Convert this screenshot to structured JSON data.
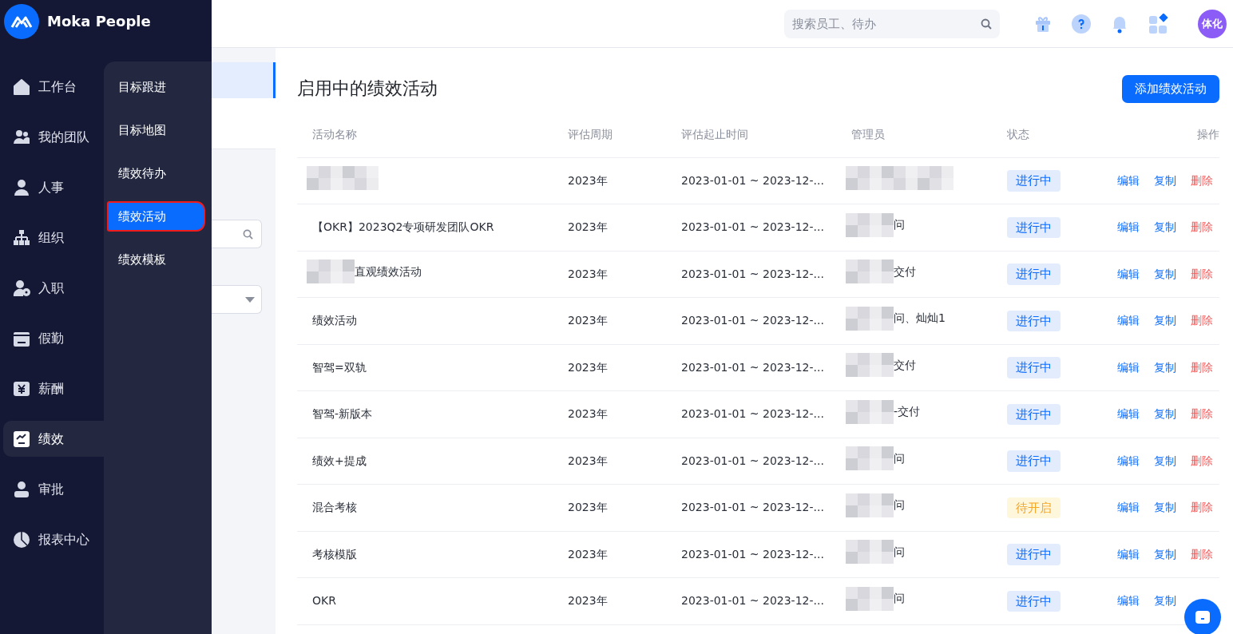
{
  "brand": {
    "name": "Moka People"
  },
  "nav": [
    {
      "label": "工作台",
      "selected": false
    },
    {
      "label": "我的团队",
      "selected": false
    },
    {
      "label": "人事",
      "selected": false
    },
    {
      "label": "组织",
      "selected": false
    },
    {
      "label": "入职",
      "selected": false
    },
    {
      "label": "假勤",
      "selected": false
    },
    {
      "label": "薪酬",
      "selected": false
    },
    {
      "label": "绩效",
      "selected": true
    },
    {
      "label": "审批",
      "selected": false
    },
    {
      "label": "报表中心",
      "selected": false
    }
  ],
  "submenu": [
    {
      "label": "目标跟进",
      "selected": false,
      "outlined": false
    },
    {
      "label": "目标地图",
      "selected": false,
      "outlined": false
    },
    {
      "label": "绩效待办",
      "selected": false,
      "outlined": false
    },
    {
      "label": "绩效活动",
      "selected": true,
      "outlined": true
    },
    {
      "label": "绩效模板",
      "selected": false,
      "outlined": false
    }
  ],
  "header": {
    "search": {
      "placeholder": "搜索员工、待办"
    },
    "avatar": "体化"
  },
  "page": {
    "title": "启用中的绩效活动",
    "add_button": "添加绩效活动"
  },
  "table": {
    "columns": [
      "活动名称",
      "评估周期",
      "评估起止时间",
      "管理员",
      "状态",
      "操作"
    ],
    "rows": [
      {
        "name": {
          "redacted": true
        },
        "period": "2023年",
        "dates": "2023-01-01 ~ 2023-12-...",
        "admin": {
          "redacted": true
        },
        "status": {
          "label": "进行中",
          "kind": "running"
        },
        "actions": [
          "编辑",
          "复制",
          "删除"
        ]
      },
      {
        "name": {
          "redacted": false,
          "text": "【OKR】2023Q2专项研发团队OKR"
        },
        "period": "2023年",
        "dates": "2023-01-01 ~ 2023-12-...",
        "admin": {
          "redacted": true,
          "text": "问"
        },
        "status": {
          "label": "进行中",
          "kind": "running"
        },
        "actions": [
          "编辑",
          "复制",
          "删除"
        ]
      },
      {
        "name": {
          "redacted": true,
          "text": "直观绩效活动"
        },
        "period": "2023年",
        "dates": "2023-01-01 ~ 2023-12-...",
        "admin": {
          "redacted": true,
          "text": "交付"
        },
        "status": {
          "label": "进行中",
          "kind": "running"
        },
        "actions": [
          "编辑",
          "复制",
          "删除"
        ]
      },
      {
        "name": {
          "redacted": false,
          "text": "绩效活动"
        },
        "period": "2023年",
        "dates": "2023-01-01 ~ 2023-12-...",
        "admin": {
          "redacted": true,
          "text": "问、灿灿1"
        },
        "status": {
          "label": "进行中",
          "kind": "running"
        },
        "actions": [
          "编辑",
          "复制",
          "删除"
        ]
      },
      {
        "name": {
          "redacted": false,
          "text": "智驾=双轨"
        },
        "period": "2023年",
        "dates": "2023-01-01 ~ 2023-12-...",
        "admin": {
          "redacted": true,
          "text": "交付"
        },
        "status": {
          "label": "进行中",
          "kind": "running"
        },
        "actions": [
          "编辑",
          "复制",
          "删除"
        ]
      },
      {
        "name": {
          "redacted": false,
          "text": "智驾-新版本"
        },
        "period": "2023年",
        "dates": "2023-01-01 ~ 2023-12-...",
        "admin": {
          "redacted": true,
          "text": "-交付"
        },
        "status": {
          "label": "进行中",
          "kind": "running"
        },
        "actions": [
          "编辑",
          "复制",
          "删除"
        ]
      },
      {
        "name": {
          "redacted": false,
          "text": "绩效+提成"
        },
        "period": "2023年",
        "dates": "2023-01-01 ~ 2023-12-...",
        "admin": {
          "redacted": true,
          "text": "问"
        },
        "status": {
          "label": "进行中",
          "kind": "running"
        },
        "actions": [
          "编辑",
          "复制",
          "删除"
        ]
      },
      {
        "name": {
          "redacted": false,
          "text": "混合考核"
        },
        "period": "2023年",
        "dates": "2023-01-01 ~ 2023-12-...",
        "admin": {
          "redacted": true,
          "text": "问"
        },
        "status": {
          "label": "待开启",
          "kind": "pending"
        },
        "actions": [
          "编辑",
          "复制",
          "删除"
        ]
      },
      {
        "name": {
          "redacted": false,
          "text": "考核模版"
        },
        "period": "2023年",
        "dates": "2023-01-01 ~ 2023-12-...",
        "admin": {
          "redacted": true,
          "text": "问"
        },
        "status": {
          "label": "进行中",
          "kind": "running"
        },
        "actions": [
          "编辑",
          "复制",
          "删除"
        ]
      },
      {
        "name": {
          "redacted": false,
          "text": "OKR"
        },
        "period": "2023年",
        "dates": "2023-01-01 ~ 2023-12-...",
        "admin": {
          "redacted": true,
          "text": "问"
        },
        "status": {
          "label": "进行中",
          "kind": "running"
        },
        "actions": [
          "编辑",
          "复制"
        ]
      }
    ]
  }
}
